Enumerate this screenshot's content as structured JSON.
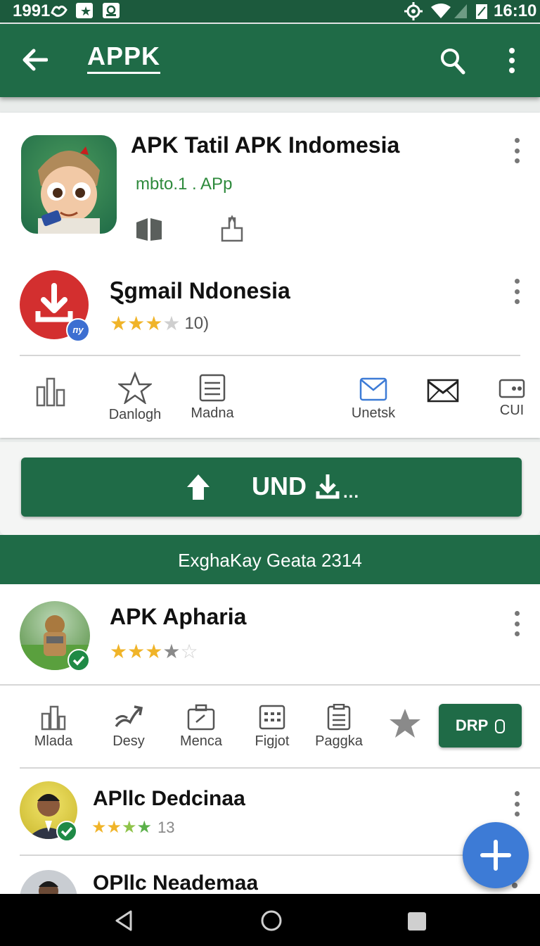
{
  "status": {
    "left_time": "1991",
    "right_time": "16:10"
  },
  "appbar": {
    "title": "APPK"
  },
  "apps": [
    {
      "title": "APK Tatil APK Indomesia",
      "subtitle": "mbto.1 . APp"
    },
    {
      "title": "Ȿgmail Ndonesia",
      "rating_text": "10)",
      "badge": "пу"
    }
  ],
  "actions_top": [
    {
      "label": ""
    },
    {
      "label": "Danlogh"
    },
    {
      "label": "Madna"
    },
    {
      "label": "Unetsk"
    },
    {
      "label": ""
    },
    {
      "label": "CUI"
    }
  ],
  "main_button": {
    "label": "UND"
  },
  "banner": {
    "text": "ExghaKay Geata 2314"
  },
  "apps2": [
    {
      "title": "APK Apharia"
    },
    {
      "title": "APllc Dedcinaa",
      "rating_text": "13"
    },
    {
      "title": "OPllc Neademaa"
    }
  ],
  "actions_bottom": [
    {
      "label": "Mlada"
    },
    {
      "label": "Desy"
    },
    {
      "label": "Menca"
    },
    {
      "label": "Figjot"
    },
    {
      "label": "Paggka"
    }
  ],
  "drp_button": {
    "label": "DRP"
  },
  "colors": {
    "primary": "#1f6b47",
    "fab": "#3d7bd6",
    "star": "#f0b429",
    "star_green": "#5bb04a"
  }
}
